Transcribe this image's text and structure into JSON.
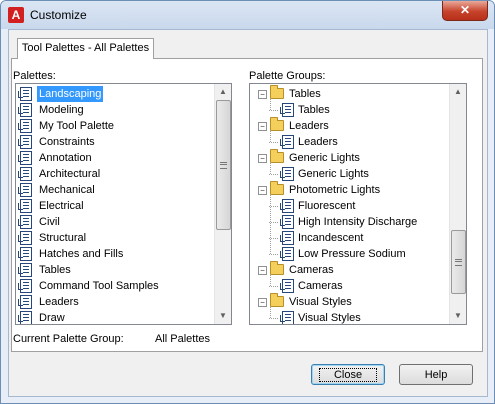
{
  "window": {
    "title": "Customize",
    "close_glyph": "✕",
    "app_icon_glyph": "A"
  },
  "tab": {
    "label": "Tool Palettes - All Palettes"
  },
  "palettes": {
    "label": "Palettes:",
    "items": [
      "Landscaping",
      "Modeling",
      "My Tool Palette",
      "Constraints",
      "Annotation",
      "Architectural",
      "Mechanical",
      "Electrical",
      "Civil",
      "Structural",
      "Hatches and Fills",
      "Tables",
      "Command Tool Samples",
      "Leaders",
      "Draw"
    ],
    "selected_index": 0
  },
  "palette_groups": {
    "label": "Palette Groups:",
    "groups": [
      {
        "name": "Tables",
        "children": [
          "Tables"
        ]
      },
      {
        "name": "Leaders",
        "children": [
          "Leaders"
        ]
      },
      {
        "name": "Generic Lights",
        "children": [
          "Generic Lights"
        ]
      },
      {
        "name": "Photometric Lights",
        "children": [
          "Fluorescent",
          "High Intensity Discharge",
          "Incandescent",
          "Low Pressure Sodium"
        ]
      },
      {
        "name": "Cameras",
        "children": [
          "Cameras"
        ]
      },
      {
        "name": "Visual Styles",
        "children": [
          "Visual Styles"
        ]
      }
    ]
  },
  "current_group": {
    "label": "Current Palette Group:",
    "value": "All Palettes"
  },
  "buttons": {
    "close": "Close",
    "help": "Help"
  },
  "colors": {
    "selection": "#3399ff",
    "titlebar": "#c9d8ec",
    "close_button": "#c7432b"
  }
}
